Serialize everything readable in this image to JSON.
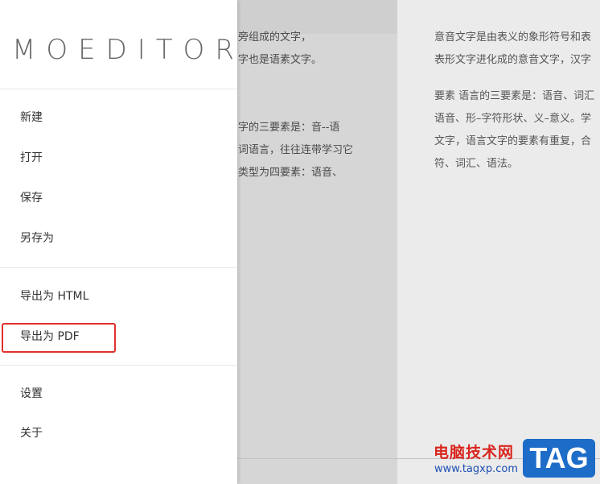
{
  "editor": {
    "left_lines": [
      "旁组成的文字，",
      "字也是语素文字。",
      "字的三要素是：音--语",
      "词语言，往往连带学习它",
      "类型为四要素：语音、"
    ],
    "right_lines": [
      "意音文字是由表义的象形符号和表",
      "表形文字进化成的意音文字，汉字",
      "要素 语言的三要素是：语音、词汇",
      "语音、形–字符形状、义–意义。学",
      "文字，语言文字的要素有重复，合",
      "符、词汇、语法。"
    ]
  },
  "drawer": {
    "logo": "MOEDITOR",
    "items": [
      {
        "label": "新建"
      },
      {
        "label": "打开"
      },
      {
        "label": "保存"
      },
      {
        "label": "另存为"
      },
      {
        "label": "导出为 HTML"
      },
      {
        "label": "导出为 PDF"
      },
      {
        "label": "设置"
      },
      {
        "label": "关于"
      }
    ]
  },
  "watermark": {
    "site_name": "电脑技术网",
    "url": "www.tagxp.com",
    "tag": "TAG"
  },
  "colors": {
    "highlight": "#e0302c",
    "watermark_red": "#d8261e",
    "watermark_blue": "#1d6cc8"
  }
}
